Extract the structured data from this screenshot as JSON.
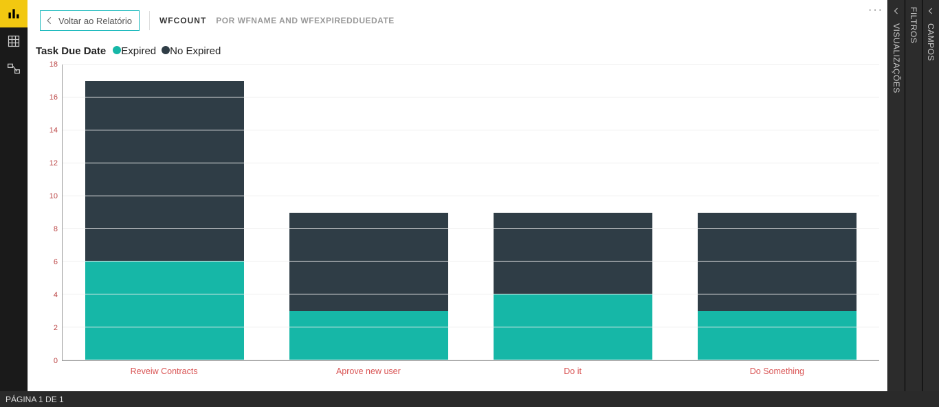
{
  "header": {
    "back_label": "Voltar ao Relatório",
    "measure": "wfCount",
    "subtitle": "por wfName and wfExpiredDueDate"
  },
  "panes": {
    "fields": "Campos",
    "viz": "Visualizações",
    "filters": "Filtros"
  },
  "status": "PÁGINA 1 DE 1",
  "chart_data": {
    "type": "bar",
    "stacked": true,
    "title": "Task Due Date",
    "xlabel": "",
    "ylabel": "",
    "ylim": [
      0,
      18
    ],
    "yticks": [
      0,
      2,
      4,
      6,
      8,
      10,
      12,
      14,
      16,
      18
    ],
    "categories": [
      "Reveiw Contracts",
      "Aprove new user",
      "Do it",
      "Do Something"
    ],
    "series": [
      {
        "name": "Expired",
        "color": "#16b7a7",
        "values": [
          6,
          3,
          4,
          3
        ]
      },
      {
        "name": "No Expired",
        "color": "#2f3d46",
        "values": [
          11,
          6,
          5,
          6
        ]
      }
    ]
  }
}
